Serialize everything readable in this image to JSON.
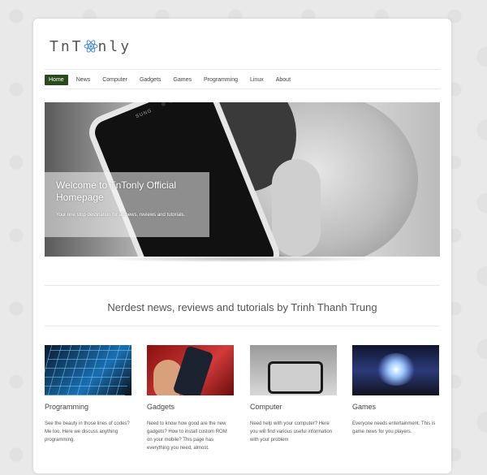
{
  "logo": {
    "text_left": "TnT",
    "text_right": "nly"
  },
  "nav": {
    "items": [
      "Home",
      "News",
      "Computer",
      "Gadgets",
      "Games",
      "Programming",
      "Linux",
      "About"
    ],
    "active_index": 0
  },
  "hero": {
    "title": "Welcome to TnTonly Official Homepage",
    "subtitle": "Your one stop destination for all news, reviews and tutorials.",
    "phone_brand": "SUNG"
  },
  "tagline": "Nerdest news, reviews and tutorials by Trinh Thanh Trung",
  "features": [
    {
      "title": "Programming",
      "text": "See the beauty in those lines of codes? Me too. Here we discuss anything programming."
    },
    {
      "title": "Gadgets",
      "text": "Need to know how good are the new gadgets? How to install custom ROM on your mobile? This page has everything you need, almost."
    },
    {
      "title": "Computer",
      "text": "Need help with your computer? Here you will find various useful information with your problem"
    },
    {
      "title": "Games",
      "text": "Everyone needs entertainment. This is game news for you players."
    }
  ],
  "colors": {
    "nav_active_bg": "#2a4a1e",
    "page_bg": "#e9e9e9",
    "card_bg": "#ffffff"
  }
}
